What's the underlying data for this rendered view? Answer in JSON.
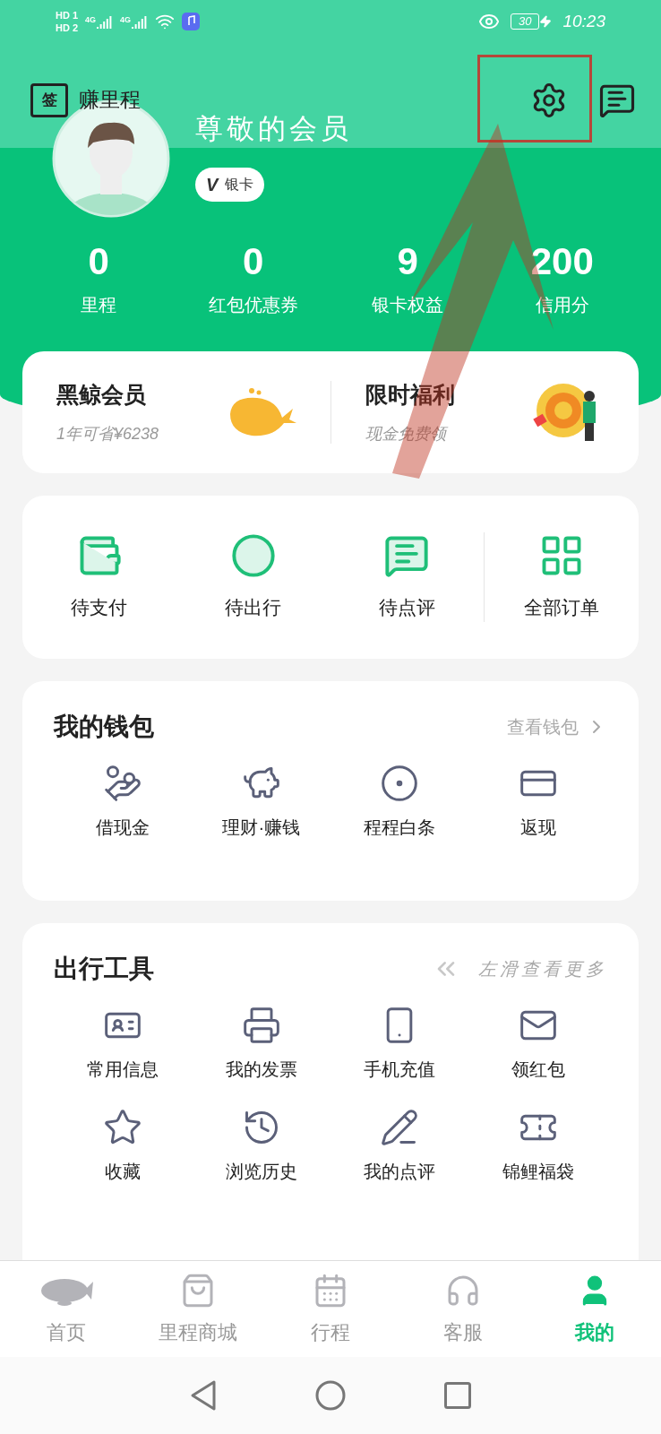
{
  "status_bar": {
    "sim_labels": [
      "HD 1",
      "HD 2"
    ],
    "network": [
      "4G",
      "4G"
    ],
    "battery": "30",
    "time": "10:23"
  },
  "header": {
    "checkin_icon": "签",
    "checkin_label": "赚里程",
    "name": "尊敬的会员",
    "badge": {
      "icon_text": "V",
      "label": "银卡"
    }
  },
  "stats": [
    {
      "value": "0",
      "label": "里程"
    },
    {
      "value": "0",
      "label": "红包优惠券"
    },
    {
      "value": "9",
      "label": "银卡权益"
    },
    {
      "value": "200",
      "label": "信用分"
    }
  ],
  "promos": [
    {
      "title": "黑鲸会员",
      "subtitle": "1年可省¥6238"
    },
    {
      "title": "限时福利",
      "subtitle": "现金免费领"
    }
  ],
  "orders": {
    "items": [
      {
        "label": "待支付"
      },
      {
        "label": "待出行"
      },
      {
        "label": "待点评"
      }
    ],
    "all": "全部订单"
  },
  "wallet": {
    "title": "我的钱包",
    "link": "查看钱包",
    "items": [
      {
        "label": "借现金"
      },
      {
        "label": "理财·赚钱"
      },
      {
        "label": "程程白条"
      },
      {
        "label": "返现"
      }
    ]
  },
  "tools": {
    "title": "出行工具",
    "hint": "左滑查看更多",
    "items": [
      {
        "label": "常用信息"
      },
      {
        "label": "我的发票"
      },
      {
        "label": "手机充值"
      },
      {
        "label": "领红包"
      },
      {
        "label": "收藏"
      },
      {
        "label": "浏览历史"
      },
      {
        "label": "我的点评"
      },
      {
        "label": "锦鲤福袋"
      }
    ]
  },
  "tabs": [
    {
      "label": "首页",
      "selected": false
    },
    {
      "label": "里程商城",
      "selected": false
    },
    {
      "label": "行程",
      "selected": false
    },
    {
      "label": "客服",
      "selected": false
    },
    {
      "label": "我的",
      "selected": true
    }
  ]
}
